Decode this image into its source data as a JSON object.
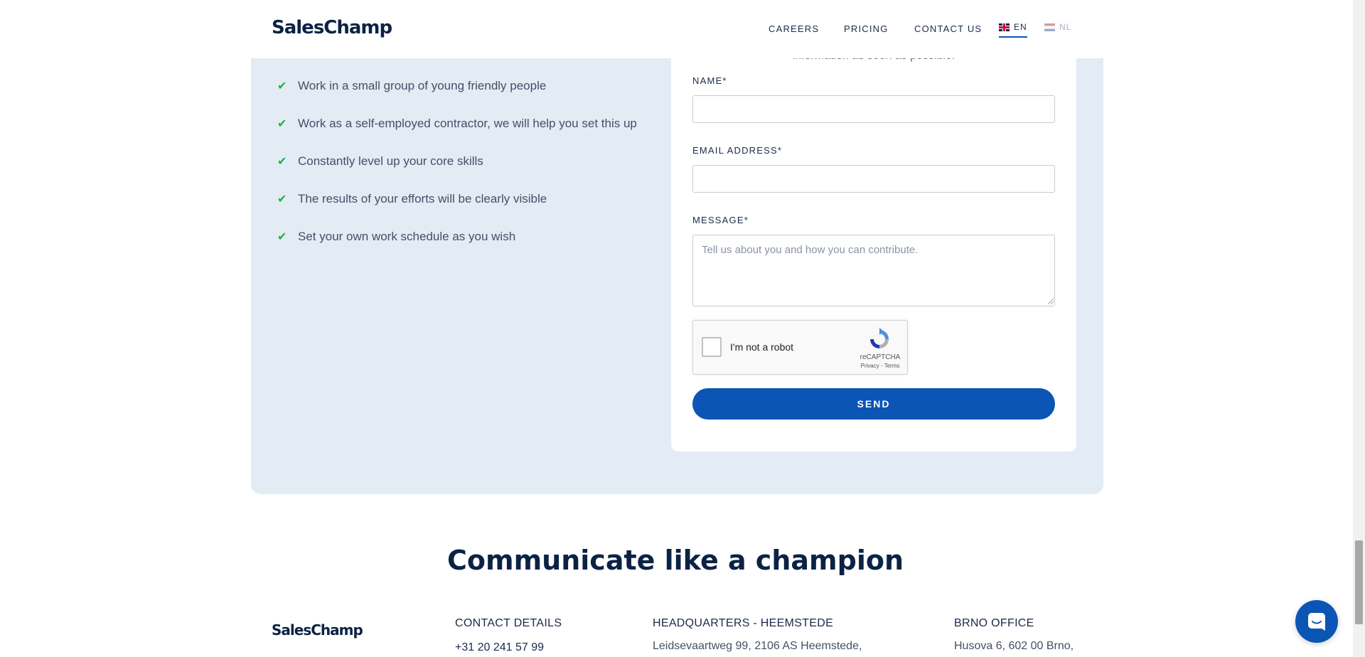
{
  "header": {
    "logo": "SalesChamp",
    "nav": [
      "CAREERS",
      "PRICING",
      "CONTACT US"
    ],
    "languages": [
      {
        "code": "EN",
        "active": true
      },
      {
        "code": "NL",
        "active": false
      }
    ]
  },
  "benefits": [
    "Work in a small group of young friendly people",
    "Work as a self-employed contractor, we will help you set this up",
    "Constantly level up your core skills",
    "The results of your efforts will be clearly visible",
    "Set your own work schedule as you wish"
  ],
  "form": {
    "intro": "information as soon as possible.",
    "name_label": "NAME*",
    "name_value": "",
    "email_label": "EMAIL ADDRESS*",
    "email_value": "",
    "message_label": "MESSAGE*",
    "message_placeholder": "Tell us about you and how you can contribute.",
    "recaptcha_label": "I'm not a robot",
    "recaptcha_brand": "reCAPTCHA",
    "recaptcha_links": "Privacy - Terms",
    "send_label": "SEND"
  },
  "footer": {
    "tagline": "Communicate like a champion",
    "logo": "SalesChamp",
    "contact": {
      "heading": "CONTACT DETAILS",
      "phone": "+31 20 241 57 99"
    },
    "hq": {
      "heading": "HEADQUARTERS - HEEMSTEDE",
      "address": "Leidsevaartweg 99, 2106 AS Heemstede,"
    },
    "brno": {
      "heading": "BRNO OFFICE",
      "address": "Husova 6, 602 00 Brno,"
    }
  },
  "colors": {
    "brand_blue": "#0b55b4",
    "panel_bg": "#e3ebf5",
    "check_green": "#1fb141",
    "navy": "#0c2245"
  }
}
